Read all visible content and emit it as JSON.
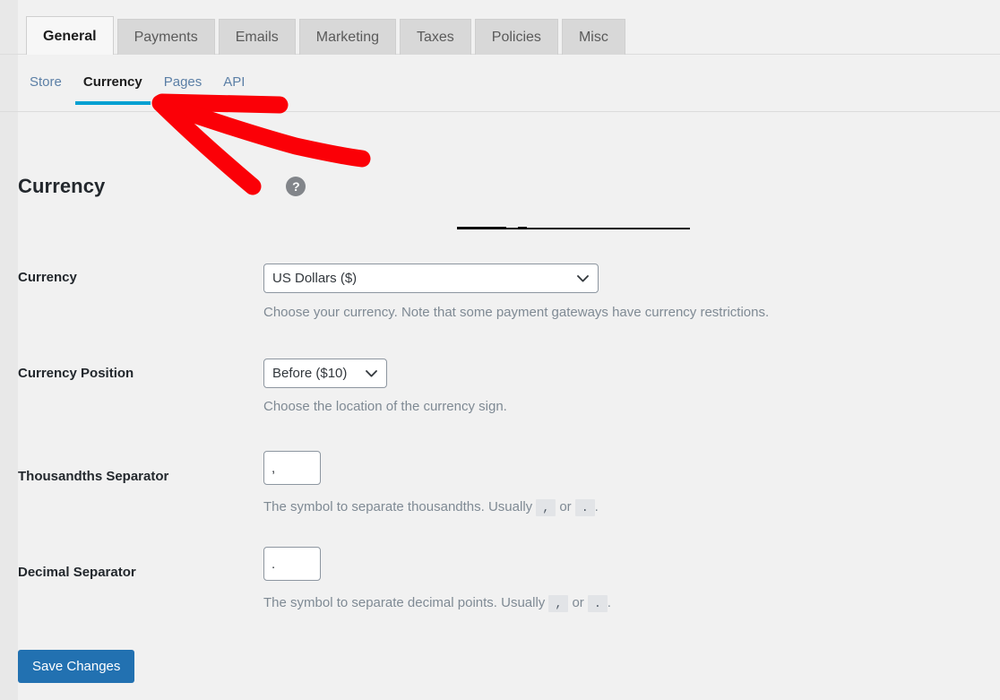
{
  "tabs": {
    "items": [
      {
        "label": "General",
        "active": true
      },
      {
        "label": "Payments",
        "active": false
      },
      {
        "label": "Emails",
        "active": false
      },
      {
        "label": "Marketing",
        "active": false
      },
      {
        "label": "Taxes",
        "active": false
      },
      {
        "label": "Policies",
        "active": false
      },
      {
        "label": "Misc",
        "active": false
      }
    ]
  },
  "subnav": {
    "items": [
      {
        "label": "Store",
        "active": false
      },
      {
        "label": "Currency",
        "active": true
      },
      {
        "label": "Pages",
        "active": false
      },
      {
        "label": "API",
        "active": false
      }
    ]
  },
  "section": {
    "title": "Currency",
    "help_icon": "question-mark-icon",
    "help_label": "?"
  },
  "fields": {
    "currency": {
      "label": "Currency",
      "value": "US Dollars ($)",
      "options": [
        "US Dollars ($)"
      ],
      "description": "Choose your currency. Note that some payment gateways have currency restrictions."
    },
    "currency_position": {
      "label": "Currency Position",
      "value": "Before ($10)",
      "options": [
        "Before ($10)"
      ],
      "description": "Choose the location of the currency sign."
    },
    "thousandths_separator": {
      "label": "Thousandths Separator",
      "value": ",",
      "placeholder": "",
      "desc_prefix": "The symbol to separate thousandths. Usually",
      "desc_code_1": ",",
      "desc_middle": "or",
      "desc_code_2": ".",
      "desc_suffix": "."
    },
    "decimal_separator": {
      "label": "Decimal Separator",
      "value": ".",
      "placeholder": "",
      "desc_prefix": "The symbol to separate decimal points. Usually",
      "desc_code_1": ",",
      "desc_middle": "or",
      "desc_code_2": ".",
      "desc_suffix": "."
    }
  },
  "actions": {
    "save_label": "Save Changes"
  },
  "colors": {
    "accent_blue": "#00a0d2",
    "button_blue": "#2271b1",
    "annotation_red": "#fb0007",
    "page_background": "#f1f1f1",
    "link_blue": "#5b7fa6",
    "help_gray": "#82858a"
  },
  "annotation": {
    "shape": "hand-drawn-arrow",
    "color": "#fb0007",
    "points_at": "Currency"
  }
}
